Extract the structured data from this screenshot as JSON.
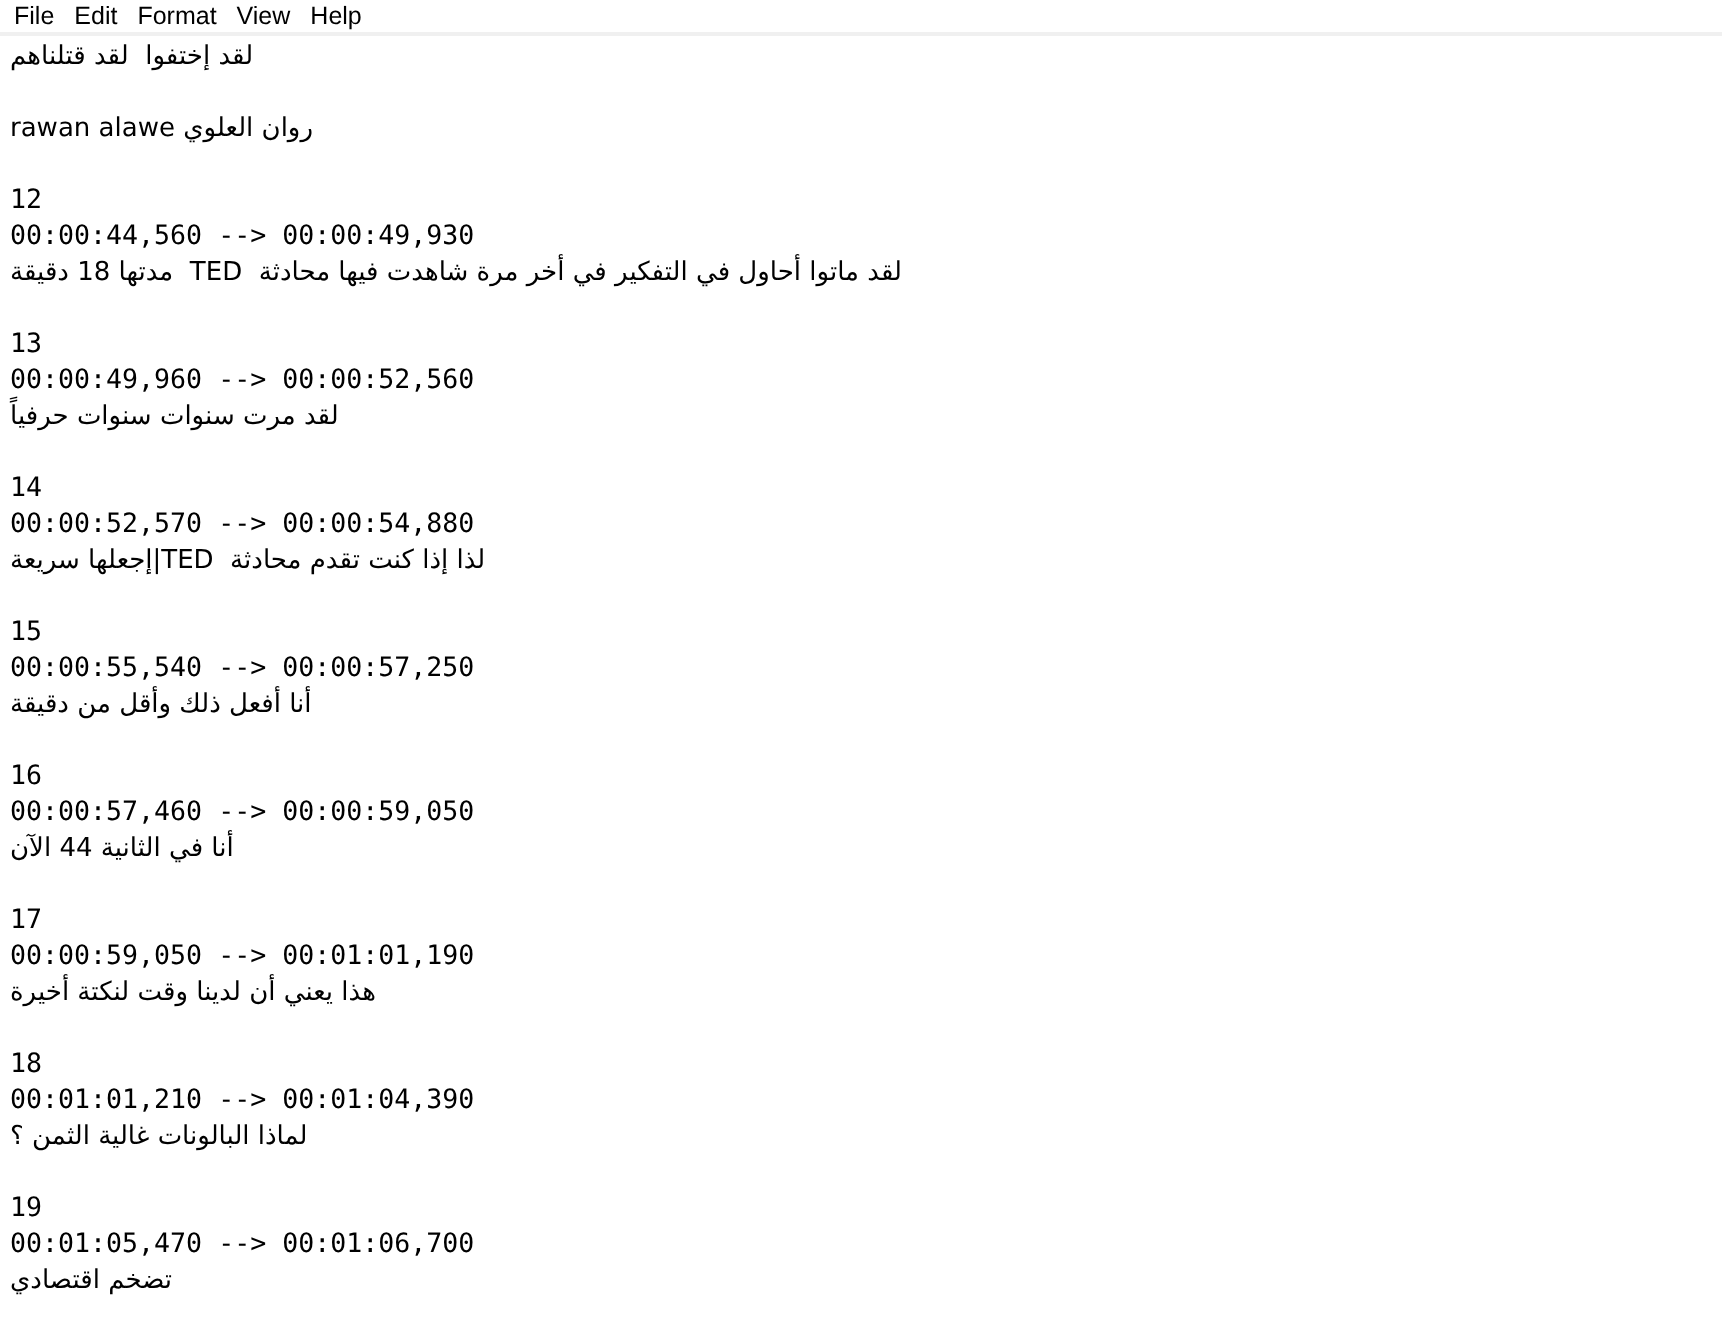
{
  "menu": {
    "file": "File",
    "edit": "Edit",
    "format": "Format",
    "view": "View",
    "help": "Help"
  },
  "preamble": [
    "لقد إختفوا  لقد قتلناهم",
    "روان العلوي rawan alawe"
  ],
  "cues": [
    {
      "index": "12",
      "timing": "00:00:44,560 --> 00:00:49,930",
      "text": "لقد ماتوا أحاول في التفكير في أخر مرة شاهدت فيها محادثة  TED  مدتها 18 دقيقة"
    },
    {
      "index": "13",
      "timing": "00:00:49,960 --> 00:00:52,560",
      "text": "لقد مرت سنوات سنوات حرفياً"
    },
    {
      "index": "14",
      "timing": "00:00:52,570 --> 00:00:54,880",
      "text": "لذا إذا كنت تقدم محادثة  TED|إجعلها سريعة"
    },
    {
      "index": "15",
      "timing": "00:00:55,540 --> 00:00:57,250",
      "text": "أنا أفعل ذلك وأقل من دقيقة"
    },
    {
      "index": "16",
      "timing": "00:00:57,460 --> 00:00:59,050",
      "text": "أنا في الثانية 44 الآن"
    },
    {
      "index": "17",
      "timing": "00:00:59,050 --> 00:01:01,190",
      "text": "هذا يعني أن لدينا وقت لنكتة أخيرة"
    },
    {
      "index": "18",
      "timing": "00:01:01,210 --> 00:01:04,390",
      "text": "لماذا البالونات غالية الثمن ؟"
    },
    {
      "index": "19",
      "timing": "00:01:05,470 --> 00:01:06,700",
      "text": "تضخم اقتصادي"
    }
  ]
}
